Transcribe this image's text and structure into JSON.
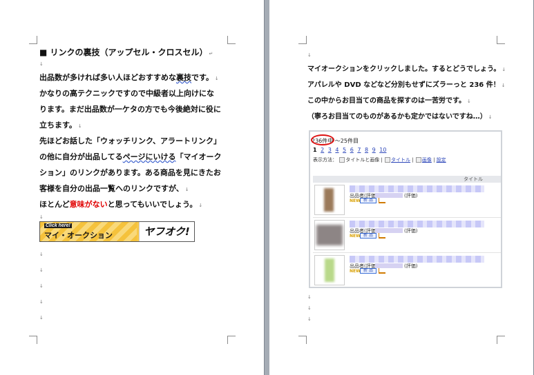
{
  "left_page": {
    "heading": "■ リンクの裏技（アップセル・クロスセル）",
    "heading_mark": "↵",
    "para_mark": "↓",
    "p1": [
      {
        "pre": "出品数が多ければ多い人ほどおすすめな",
        "squig": "裏技",
        "post": "です。"
      },
      {
        "pre": "かなりの高テクニックですので中級者以上向けにな",
        "squig": "",
        "post": ""
      },
      {
        "pre": "ります。まだ出品数が一ケタの方でも今後絶対に役に",
        "squig": "",
        "post": ""
      },
      {
        "pre": "立ちます。",
        "squig": "",
        "post": ""
      }
    ],
    "p2": [
      {
        "pre": "先ほどお話した「ウォッチリンク、アラートリンク」",
        "squig": "",
        "post": ""
      },
      {
        "pre": "の他に自分が出品してる",
        "squig": "ページにいける",
        "post": "「マイオーク"
      },
      {
        "pre": "ション」のリンクがあります。ある商品を見にきたお",
        "squig": "",
        "post": ""
      },
      {
        "pre": "客様を自分の出品一覧へのリンクですが、",
        "squig": "",
        "post": ""
      }
    ],
    "p3": {
      "pre": "ほとんど",
      "red": "意味がない",
      "post": "と思ってもいいでしょう。"
    },
    "banner": {
      "click_here": "Click here!",
      "my_auction": "マイ・オークション",
      "logo": "ヤフオク!"
    }
  },
  "right_page": {
    "lines": [
      "マイオークションをクリックしました。するとどうでしょう。",
      "アパレルや DVD などなど分別もせずにズラーっと 236 件！",
      "この中からお目当ての商品を探すのは一苦労です。",
      "（寧ろお目当てのものがあるかも定かではないですね…）"
    ],
    "screenshot": {
      "count_text": "236件中 ～25件目",
      "pages": [
        "1",
        "2",
        "3",
        "4",
        "5",
        "6",
        "7",
        "8",
        "9",
        "10"
      ],
      "display_label": "表示方法：",
      "display_opts": [
        "タイトルと画像",
        "タイトル",
        "画像",
        "設定"
      ],
      "col_title": "タイトル",
      "items": [
        {
          "seller": "出品者(評価)：",
          "rating": "(評価)",
          "new_label": "NEW!",
          "badge": "新 品"
        },
        {
          "seller": "出品者(評価)：",
          "rating": "(評価)",
          "new_label": "NEW!",
          "badge": "新 品"
        },
        {
          "seller": "出品者(評価)：",
          "rating": "(評価)",
          "new_label": "NEW!",
          "badge": "新 品"
        }
      ]
    }
  }
}
